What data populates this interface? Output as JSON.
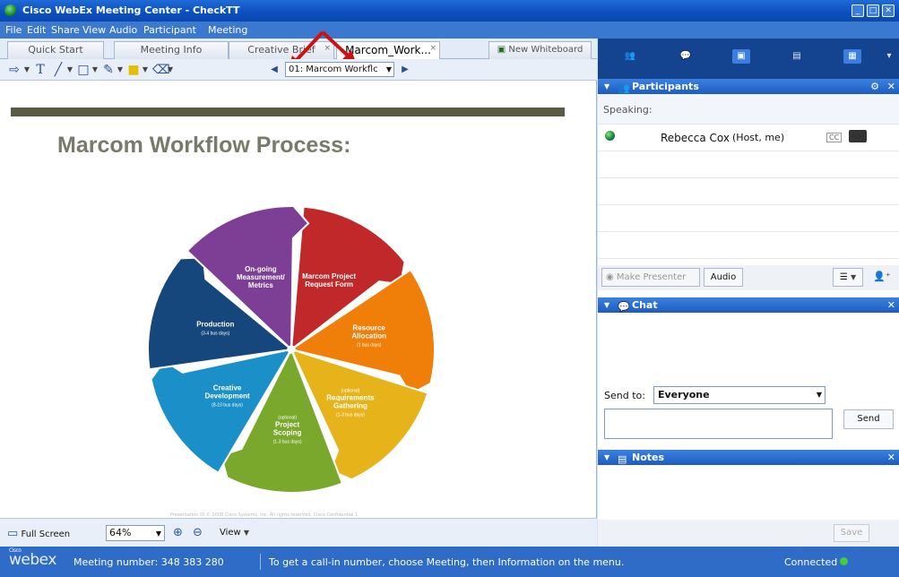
{
  "window": {
    "title": "Cisco WebEx Meeting Center - CheckTT",
    "controls": [
      "_",
      "□",
      "✕"
    ]
  },
  "menu": [
    "File",
    "Edit",
    "Share",
    "View",
    "Audio",
    "Participant",
    "Meeting"
  ],
  "tabs": [
    {
      "label": "Quick Start",
      "active": false
    },
    {
      "label": "Meeting Info",
      "active": false
    },
    {
      "label": "Creative Brief",
      "active": false
    },
    {
      "label": "Marcom_Work...",
      "active": true
    }
  ],
  "new_whiteboard": "New Whiteboard",
  "toolbar": {
    "slide_select": "01: Marcom Workflc"
  },
  "slide": {
    "title": "Marcom Workflow Process:",
    "footer": "Presentation ID  © 2008 Cisco Systems, Inc. All rights reserved.  Cisco Confidential  1",
    "segments": [
      {
        "line1": "Marcom Project",
        "line2": "Request Form",
        "line3": "",
        "note": "",
        "color": "#c0282a"
      },
      {
        "line1": "Resource",
        "line2": "Allocation",
        "line3": "",
        "note": "(1 bus days)",
        "color": "#f07f0a"
      },
      {
        "line1": "Requirements",
        "line2": "Gathering",
        "line3": "",
        "note": "(1-3 bus days)",
        "pre": "(optional)",
        "color": "#e6b41a"
      },
      {
        "line1": "Project",
        "line2": "Scoping",
        "line3": "",
        "note": "(1-3 bus days)",
        "pre": "(optional)",
        "color": "#7aa82c"
      },
      {
        "line1": "Creative",
        "line2": "Development",
        "line3": "",
        "note": "(8-10 bus days)",
        "color": "#1b90c8"
      },
      {
        "line1": "Production",
        "line2": "",
        "line3": "",
        "note": "(3-4 bus days)",
        "color": "#15467c"
      },
      {
        "line1": "On-going",
        "line2": "Measurement/",
        "line3": "Metrics",
        "note": "",
        "color": "#7d3f96"
      }
    ]
  },
  "bottom_bar": {
    "full_screen": "Full Screen",
    "zoom": "64%",
    "view": "View"
  },
  "status": {
    "logo_small": "Cisco",
    "logo": "webex",
    "meeting_number": "Meeting number: 348 383 280",
    "callin_tip": "To get a call-in number, choose Meeting, then Information on the menu.",
    "connected": "Connected"
  },
  "participants_panel": {
    "title": "Participants",
    "speaking_label": "Speaking:",
    "participant_name": "Rebecca Cox",
    "participant_role": "(Host, me)",
    "cc_label": "CC",
    "make_presenter": "Make Presenter",
    "audio": "Audio"
  },
  "chat_panel": {
    "title": "Chat",
    "send_to_label": "Send to:",
    "send_to_value": "Everyone",
    "send": "Send"
  },
  "notes_panel": {
    "title": "Notes",
    "save": "Save"
  },
  "colors": {
    "title_bar": "#0a4fbf",
    "panel_header": "#1d5cbf",
    "status_bar": "#2f6cc8",
    "annotation_arrow": "#cc1111"
  }
}
